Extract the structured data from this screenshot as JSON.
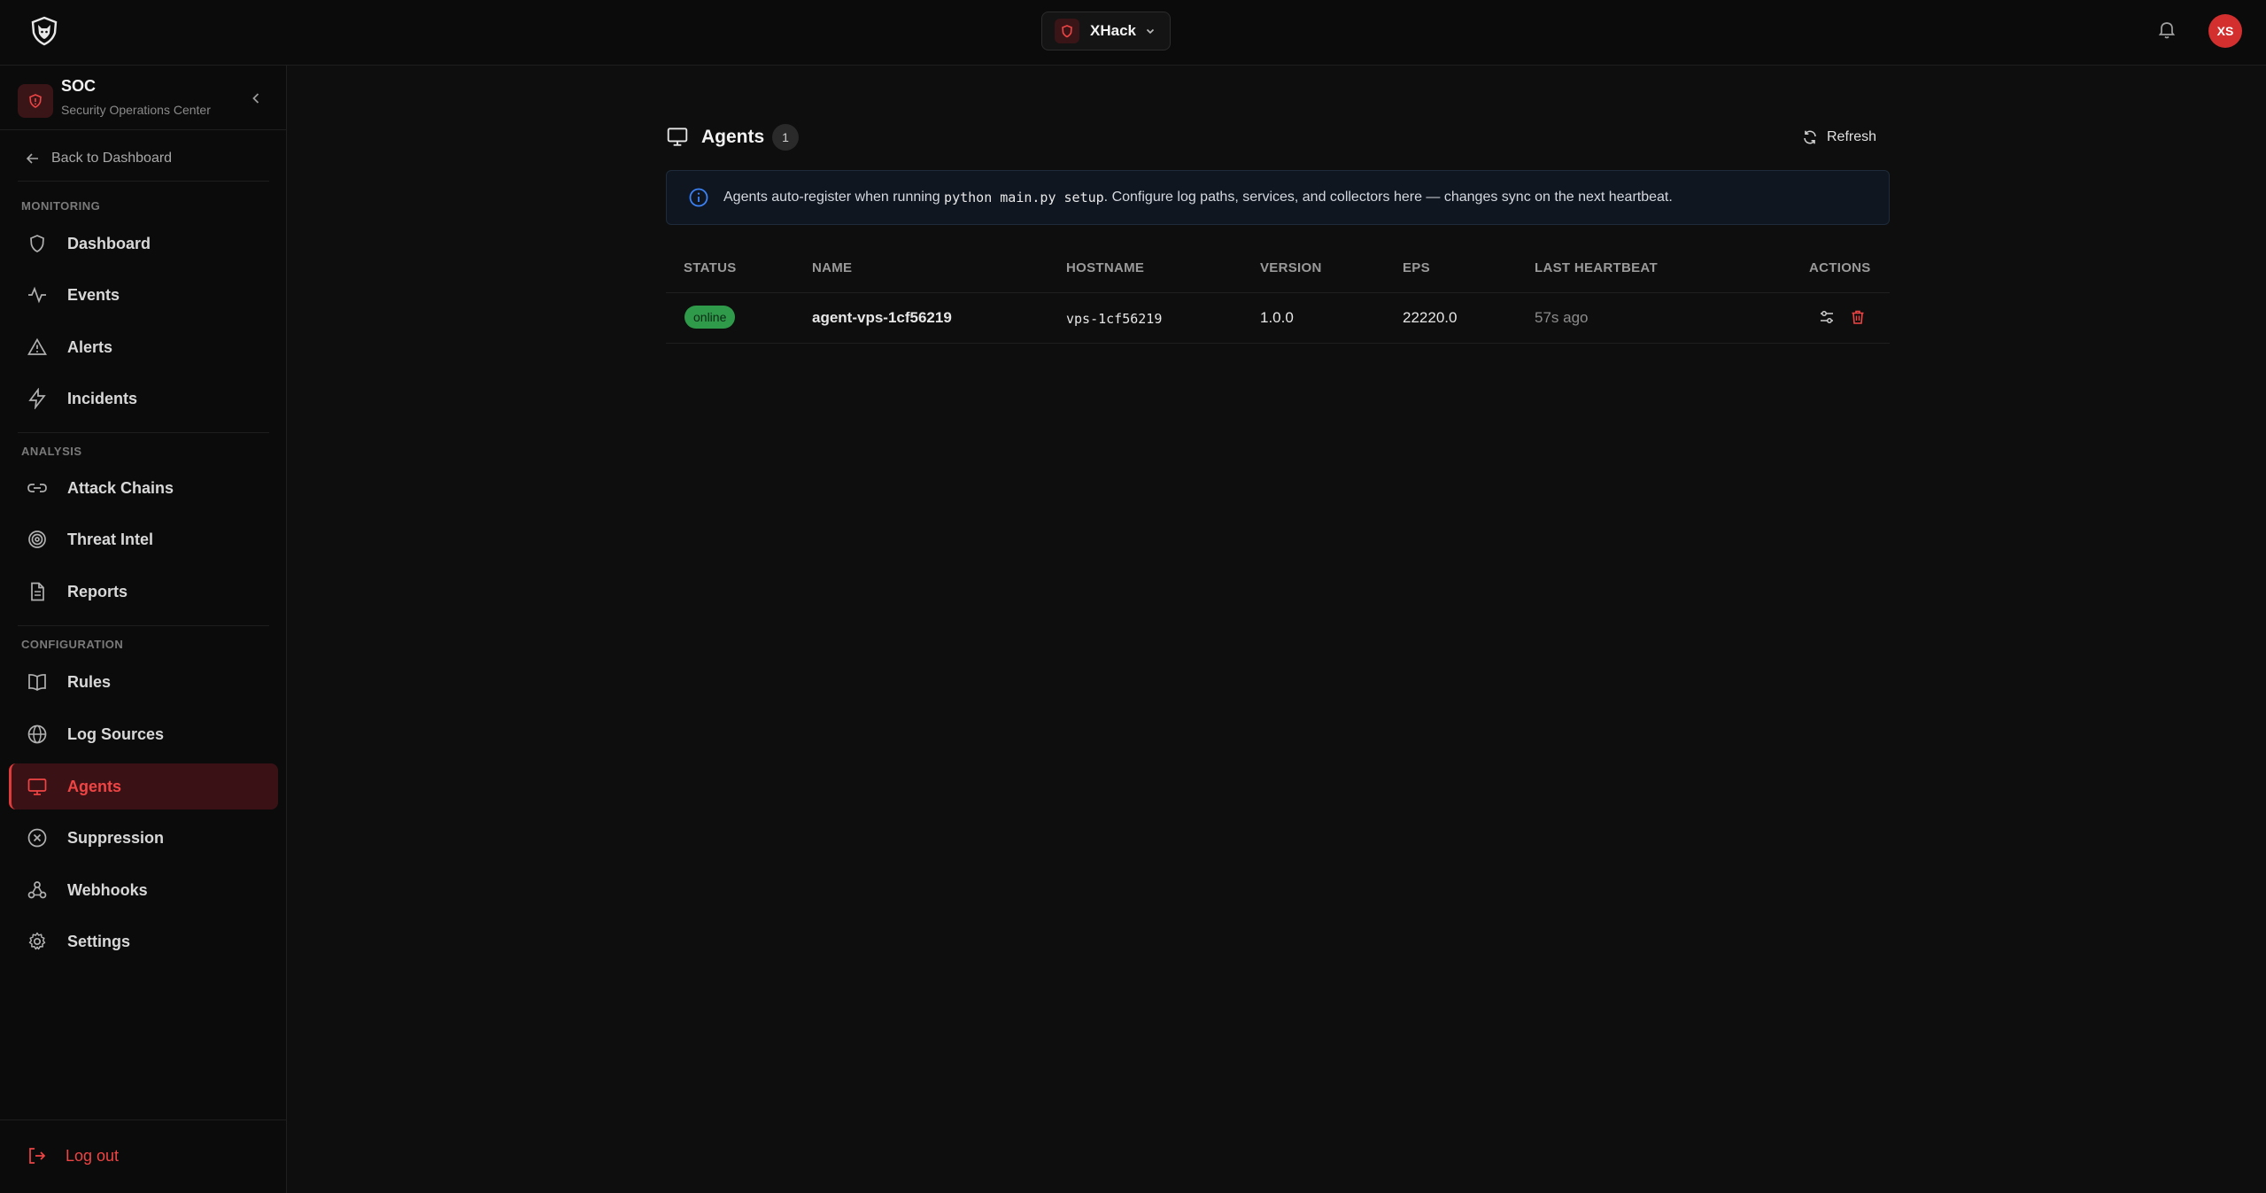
{
  "topbar": {
    "workspace_name": "XHack",
    "avatar_initials": "XS"
  },
  "sidebar": {
    "title": "SOC",
    "subtitle": "Security Operations Center",
    "back_label": "Back to Dashboard",
    "sections": {
      "monitoring": "MONITORING",
      "analysis": "ANALYSIS",
      "configuration": "CONFIGURATION"
    },
    "items": [
      {
        "label": "Dashboard",
        "icon": "shield-icon"
      },
      {
        "label": "Events",
        "icon": "activity-icon"
      },
      {
        "label": "Alerts",
        "icon": "warning-triangle-icon"
      },
      {
        "label": "Incidents",
        "icon": "lightning-icon"
      },
      {
        "label": "Attack Chains",
        "icon": "link-icon"
      },
      {
        "label": "Threat Intel",
        "icon": "target-icon"
      },
      {
        "label": "Reports",
        "icon": "document-icon"
      },
      {
        "label": "Rules",
        "icon": "book-icon"
      },
      {
        "label": "Log Sources",
        "icon": "globe-icon"
      },
      {
        "label": "Agents",
        "icon": "monitor-icon",
        "active": true
      },
      {
        "label": "Suppression",
        "icon": "x-circle-icon"
      },
      {
        "label": "Webhooks",
        "icon": "webhook-icon"
      },
      {
        "label": "Settings",
        "icon": "gear-icon"
      }
    ],
    "logout_label": "Log out"
  },
  "main": {
    "title": "Agents",
    "count": "1",
    "refresh_label": "Refresh",
    "info": {
      "prefix": "Agents auto-register when running ",
      "code": "python main.py setup",
      "suffix": ". Configure log paths, services, and collectors here — changes sync on the next heartbeat."
    },
    "table": {
      "headers": [
        "STATUS",
        "NAME",
        "HOSTNAME",
        "VERSION",
        "EPS",
        "LAST HEARTBEAT",
        "ACTIONS"
      ],
      "rows": [
        {
          "status": "online",
          "name": "agent-vps-1cf56219",
          "hostname": "vps-1cf56219",
          "version": "1.0.0",
          "eps": "22220.0",
          "last_heartbeat": "57s ago"
        }
      ]
    }
  },
  "colors": {
    "accent": "#ef4444",
    "active_bg": "#3a1216",
    "online": "#2e9a4a",
    "background": "#0e0e0e"
  }
}
